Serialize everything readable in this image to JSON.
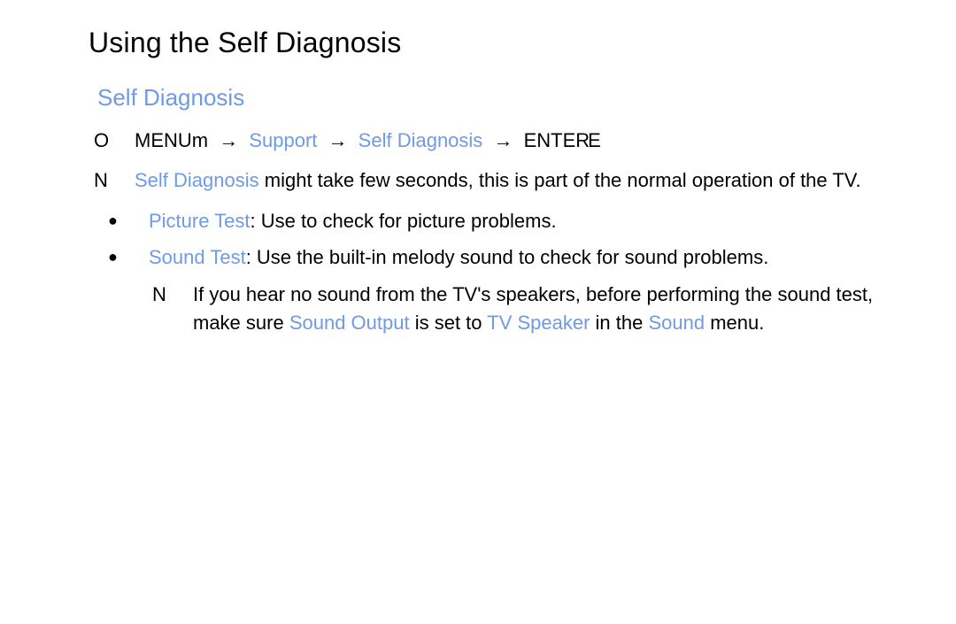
{
  "title": "Using the Self Diagnosis",
  "subtitle": "Self Diagnosis",
  "nav": {
    "marker": "O",
    "menu_label": "MENU",
    "menu_suffix": "m",
    "arrow": "→",
    "support": "Support",
    "self_diag": "Self Diagnosis",
    "enter_label": "ENTER",
    "enter_suffix": "E"
  },
  "note1": {
    "marker": "N",
    "hl": "Self Diagnosis",
    "rest": " might take few seconds, this is part of the normal operation of the TV."
  },
  "tests": {
    "picture": {
      "label": "Picture Test",
      "desc": ": Use to check for picture problems."
    },
    "sound": {
      "label": "Sound Test",
      "desc": ": Use the built-in melody sound to check for sound problems."
    }
  },
  "sound_note": {
    "marker": "N",
    "p1": "If you hear no sound from the TV's speakers, before performing the sound test, make sure ",
    "sound_output": "Sound Output",
    "p2": " is set to ",
    "tv_speaker": "TV Speaker",
    "p3": " in the ",
    "sound_menu": "Sound",
    "p4": " menu."
  },
  "bullet": "●"
}
